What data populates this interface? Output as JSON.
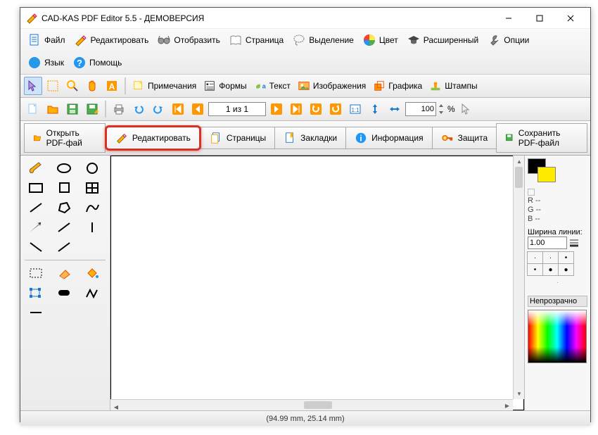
{
  "window": {
    "title": "CAD-KAS PDF Editor 5.5 - ДЕМОВЕРСИЯ"
  },
  "menu": {
    "file": "Файл",
    "edit": "Редактировать",
    "view": "Отобразить",
    "page": "Страница",
    "select": "Выделение",
    "color": "Цвет",
    "advanced": "Расширенный",
    "options": "Опции",
    "language": "Язык",
    "help": "Помощь"
  },
  "toolbar1": {
    "notes": "Примечания",
    "forms": "Формы",
    "text": "Текст",
    "images": "Изображения",
    "graphics": "Графика",
    "stamps": "Штампы"
  },
  "toolbar2": {
    "page_display": "1 из 1",
    "zoom_value": "100",
    "zoom_unit": "%"
  },
  "tabs": {
    "open": "Открыть PDF-фай",
    "edit": "Редактировать",
    "pages": "Страницы",
    "bookmarks": "Закладки",
    "info": "Информация",
    "protect": "Защита",
    "save": "Сохранить PDF-файл"
  },
  "right": {
    "r": "R --",
    "g": "G --",
    "b": "B --",
    "linewidth_label": "Ширина линии:",
    "linewidth_value": "1.00",
    "opacity_label": "Непрозрачно"
  },
  "status": {
    "text": "(94.99 mm, 25.14 mm)"
  }
}
